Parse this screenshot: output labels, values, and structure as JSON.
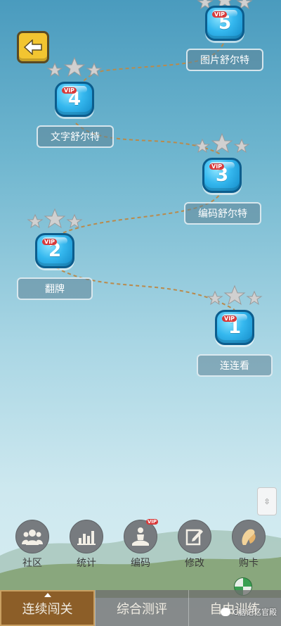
{
  "levels": [
    {
      "number": "5",
      "badge": "VIP",
      "label": "图片舒尔特"
    },
    {
      "number": "4",
      "badge": "VIP",
      "label": "文字舒尔特"
    },
    {
      "number": "3",
      "badge": "VIP",
      "label": "编码舒尔特"
    },
    {
      "number": "2",
      "badge": "VIP",
      "label": "翻牌"
    },
    {
      "number": "1",
      "badge": "VIP",
      "label": "连连看"
    }
  ],
  "toolbar": [
    {
      "label": "社区",
      "icon": "community-icon"
    },
    {
      "label": "统计",
      "icon": "stats-icon"
    },
    {
      "label": "编码",
      "icon": "meditation-icon",
      "badge": "VIP"
    },
    {
      "label": "修改",
      "icon": "edit-icon"
    },
    {
      "label": "购卡",
      "icon": "card-icon"
    }
  ],
  "tabs": [
    {
      "label": "连续闯关",
      "active": true
    },
    {
      "label": "综合测评",
      "active": false
    },
    {
      "label": "自由训练",
      "active": false
    }
  ],
  "watermark": "C脑记忆官殿",
  "colors": {
    "accent": "#f2c531",
    "tab_active": "#8c5e28",
    "bubble": "#35b8ef",
    "vip": "#d83a3a"
  }
}
